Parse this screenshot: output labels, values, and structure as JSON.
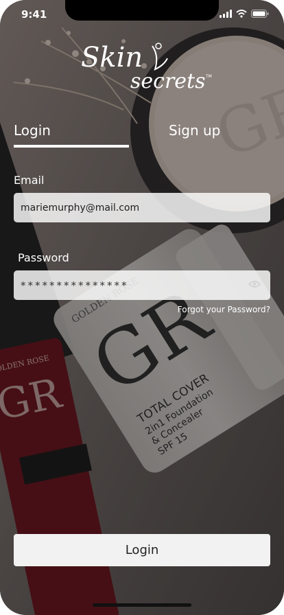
{
  "status_bar": {
    "time": "9:41"
  },
  "brand": {
    "line1": "Skin",
    "line2": "secrets",
    "trademark": "TM"
  },
  "tabs": [
    {
      "label": "Login",
      "active": true
    },
    {
      "label": "Sign up",
      "active": false
    }
  ],
  "form": {
    "email_label": "Email",
    "email_value": "mariemurphy@mail.com",
    "password_label": "Password",
    "password_value": "***************",
    "forgot_link": "Forgot your Password?"
  },
  "actions": {
    "login_button": "Login"
  },
  "product_text": {
    "brand": "GOLDEN ROSE",
    "line1": "TOTAL COVER",
    "line2": "2in1 Foundation",
    "line3": "& Concealer",
    "line4": "SPF 15",
    "lipstick_brand": "GOLDEN ROSE"
  },
  "colors": {
    "overlay": "#141212",
    "field_bg": "#ffffff",
    "button_bg": "#f2f2f2",
    "text": "#ffffff"
  }
}
